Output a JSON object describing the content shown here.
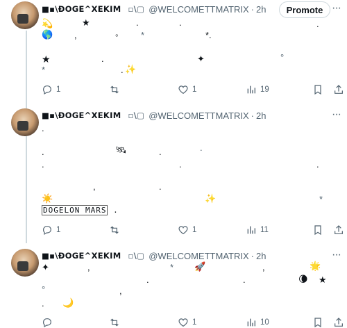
{
  "posts": [
    {
      "author": "■▪\\ÐOGE^XEKIM",
      "box_mark": "▫\\▢",
      "handle": "@WELCOMETTMATRIX",
      "time": "2h",
      "promote_label": "Promote",
      "more": "···",
      "lines": [
        {
          "text": "★",
          "emoji": false
        },
        {
          "text": "🌎",
          "emoji": true
        },
        {
          "text": "✨",
          "emoji": true
        }
      ],
      "actions": {
        "replies": "1",
        "reposts": "",
        "likes": "1",
        "views": "19"
      }
    },
    {
      "author": "■▪\\ÐOGE^XEKIM",
      "box_mark": "▫\\▢",
      "handle": "@WELCOMETTMATRIX",
      "time": "2h",
      "more": "···",
      "sun": "☀️",
      "satellite": "🛰",
      "sparkles": "✨",
      "banner": "DOGELON MARS",
      "banner_tail": ".",
      "actions": {
        "replies": "1",
        "reposts": "",
        "likes": "1",
        "views": "11"
      }
    },
    {
      "author": "■▪\\ÐOGE^XEKIM",
      "box_mark": "▫\\▢",
      "handle": "@WELCOMETTMATRIX",
      "time": "2h",
      "more": "···",
      "rocket": "🚀",
      "star_glow": "🌟",
      "moon": "🌘",
      "crescent": "🌙",
      "actions": {
        "replies": "",
        "reposts": "",
        "likes": "1",
        "views": "10"
      }
    }
  ],
  "glyphs": {
    "star": "★",
    "sparkle": "✦",
    "dot": ".",
    "comma": ",",
    "degree": "°",
    "asterisk": "*",
    "small_o": "◦"
  },
  "colors": {
    "text": "#0f1419",
    "muted": "#536471",
    "border": "#cfd9de"
  }
}
